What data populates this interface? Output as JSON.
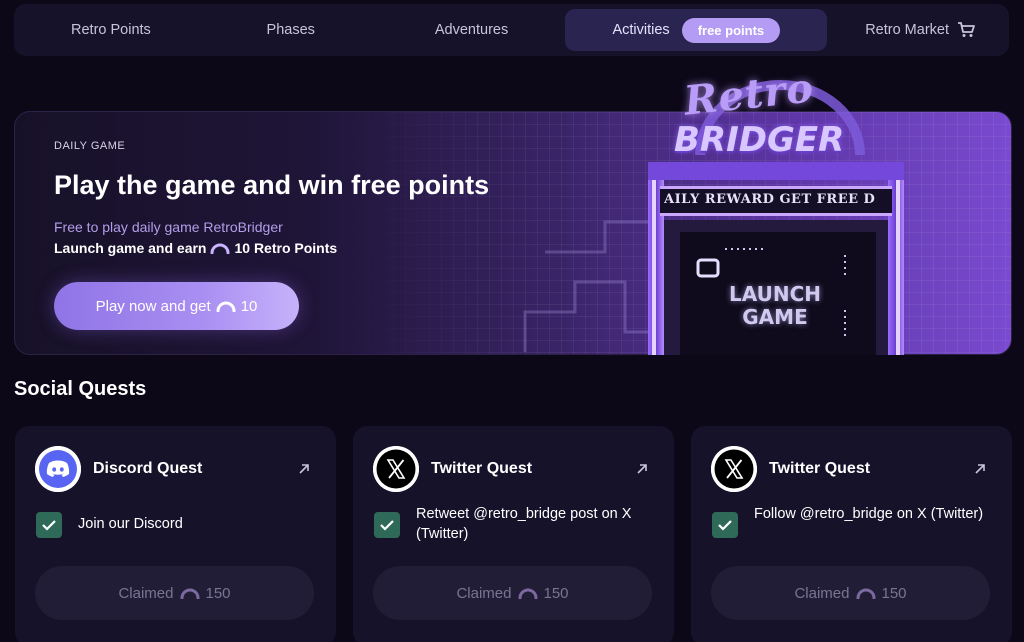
{
  "nav": {
    "items": [
      {
        "label": "Retro Points"
      },
      {
        "label": "Phases"
      },
      {
        "label": "Adventures"
      },
      {
        "label": "Activities",
        "badge": "free points",
        "active": true
      },
      {
        "label": "Retro Market",
        "icon": "cart-icon"
      }
    ]
  },
  "hero": {
    "eyebrow": "DAILY GAME",
    "title": "Play the game and win free points",
    "subtitle": "Free to play daily game RetroBridger",
    "earn_prefix": "Launch game and earn",
    "earn_suffix": "10 Retro Points",
    "button_prefix": "Play now and get",
    "button_points": "10",
    "art": {
      "logo_top": "Retro",
      "logo_bottom": "BRIDGER",
      "marquee": "AILY REWARD  GET FREE D",
      "screen_text_1": "LAUNCH",
      "screen_text_2": "GAME"
    }
  },
  "social": {
    "title": "Social Quests",
    "cards": [
      {
        "title": "Discord Quest",
        "icon": "discord-icon",
        "task": "Join our Discord",
        "status": "Claimed",
        "points": "150"
      },
      {
        "title": "Twitter Quest",
        "icon": "x-logo-icon",
        "task": "Retweet @retro_bridge post on X (Twitter)",
        "status": "Claimed",
        "points": "150"
      },
      {
        "title": "Twitter Quest",
        "icon": "x-logo-icon",
        "task": "Follow @retro_bridge on X (Twitter)",
        "status": "Claimed",
        "points": "150"
      }
    ]
  },
  "colors": {
    "background": "#0c0818",
    "card": "#16122a",
    "accent": "#b49cf5",
    "check": "#2f6a59"
  }
}
